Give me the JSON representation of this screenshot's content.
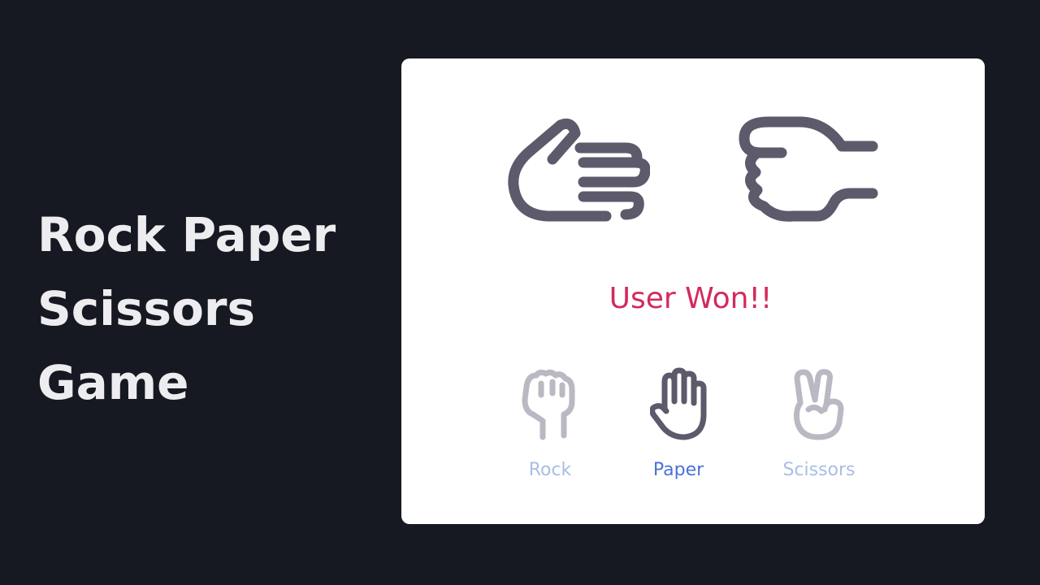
{
  "title_lines": [
    "Rock Paper",
    "Scissors",
    "Game"
  ],
  "game": {
    "user_hand": "paper-hand-icon",
    "computer_hand": "rock-hand-icon",
    "result": "User Won!!",
    "selected_choice": "Paper",
    "choices": [
      {
        "label": "Rock",
        "icon": "rock-icon",
        "selected": false
      },
      {
        "label": "Paper",
        "icon": "paper-icon",
        "selected": true
      },
      {
        "label": "Scissors",
        "icon": "scissors-icon",
        "selected": false
      }
    ]
  },
  "colors": {
    "background": "#161922",
    "card": "#ffffff",
    "title": "#ededf0",
    "hand_stroke": "#5c5a6b",
    "result_text": "#d42a5c",
    "selected_label": "#4a73d8",
    "unselected_label": "#a9bde6",
    "unselected_icon": "#b9b8c3"
  }
}
